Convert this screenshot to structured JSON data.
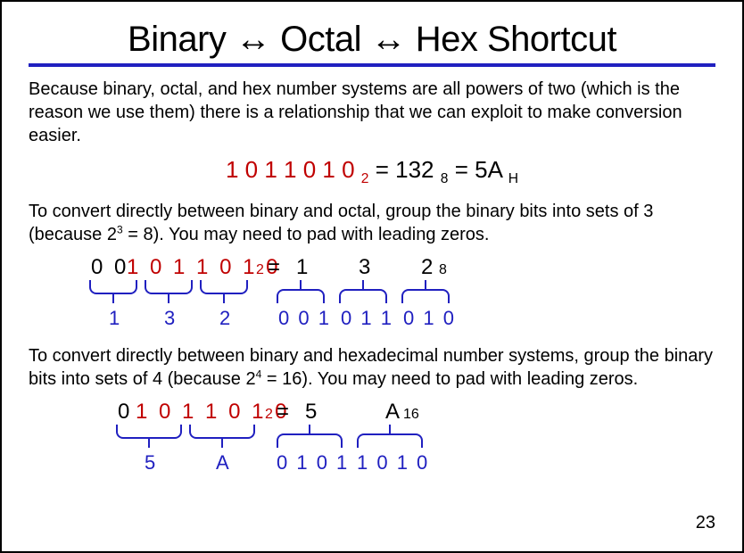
{
  "title": "Binary ↔ Octal ↔ Hex Shortcut",
  "para1": "Because binary, octal, and hex number systems are all powers of two (which is the reason we use them) there is a relationship that we can exploit to make conversion easier.",
  "mainEq": {
    "binary": "1 0 1 1 0 1 0",
    "binBase": "2",
    "octal": "132",
    "octBase": "8",
    "hex": "5A",
    "hexBase": "H"
  },
  "para2a": "To convert directly between binary and octal, group the binary bits into sets of 3 (because 2",
  "para2exp": "3",
  "para2b": " = 8). You may need to pad with leading zeros.",
  "octalDemo": {
    "pad": "0 0 ",
    "bits": "1 0 1 1 0 1 0",
    "base": "2",
    "eq": " = ",
    "r1": "1",
    "r2": "3",
    "r3": "2",
    "rBase": "8",
    "g1": "1",
    "g2": "3",
    "g3": "2",
    "b1": "0 0 1",
    "b2": "0 1 1",
    "b3": "0 1 0"
  },
  "para3a": "To convert directly between binary and hexadecimal number systems, group the binary bits into sets of 4 (because 2",
  "para3exp": "4",
  "para3b": " = 16). You may need to pad with leading zeros.",
  "hexDemo": {
    "pad": "0 ",
    "bits": "1 0 1 1 0 1 0",
    "base": "2",
    "eq": " = ",
    "r1": "5",
    "r2": "A",
    "rBase": "16",
    "g1": "5",
    "g2": "A",
    "b1": "0 1 0 1",
    "b2": "1 0 1 0"
  },
  "pageNum": "23"
}
